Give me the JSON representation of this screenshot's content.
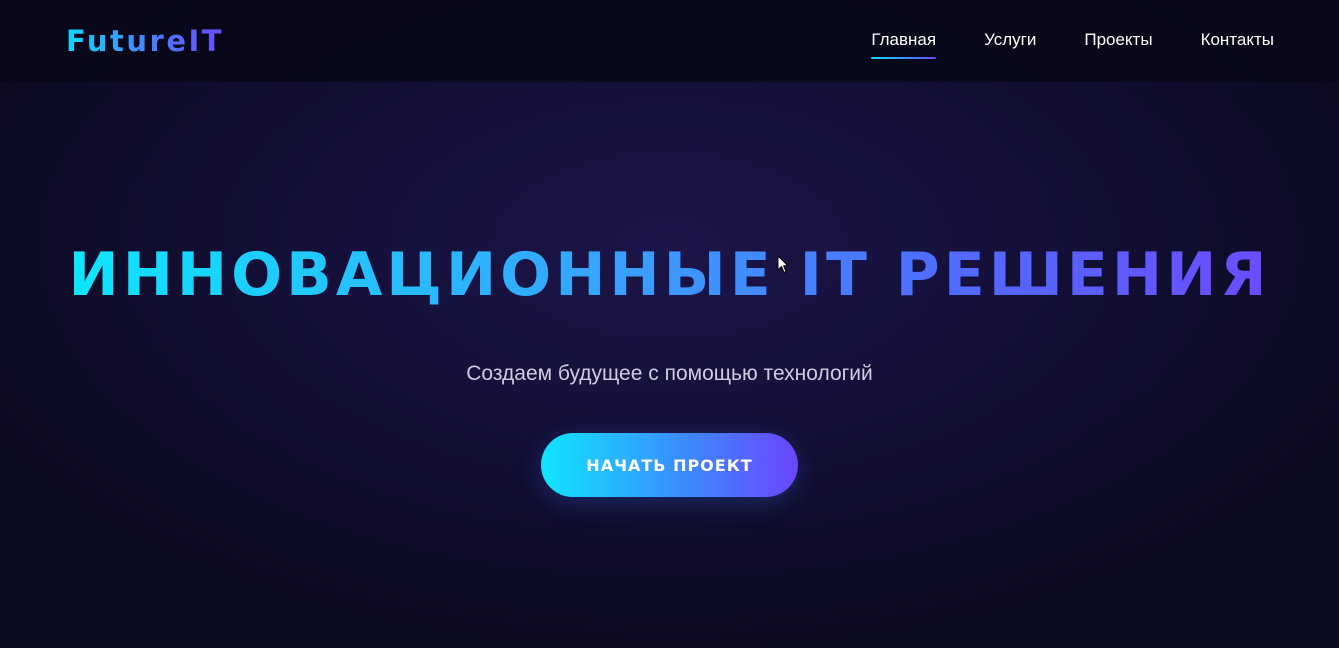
{
  "header": {
    "logo": "FutureIT",
    "nav": [
      {
        "label": "Главная",
        "active": true
      },
      {
        "label": "Услуги",
        "active": false
      },
      {
        "label": "Проекты",
        "active": false
      },
      {
        "label": "Контакты",
        "active": false
      }
    ]
  },
  "hero": {
    "title": "ИННОВАЦИОННЫЕ IT РЕШЕНИЯ",
    "subtitle": "Создаем будущее с помощью технологий",
    "cta_label": "НАЧАТЬ ПРОЕКТ"
  },
  "colors": {
    "background": "#141039",
    "header_background": "#09091a",
    "gradient_start": "#0fe6ff",
    "gradient_end": "#6a45ff",
    "subtitle_text": "#cfcde0"
  },
  "icons": {
    "cursor": "mouse-pointer-icon"
  }
}
